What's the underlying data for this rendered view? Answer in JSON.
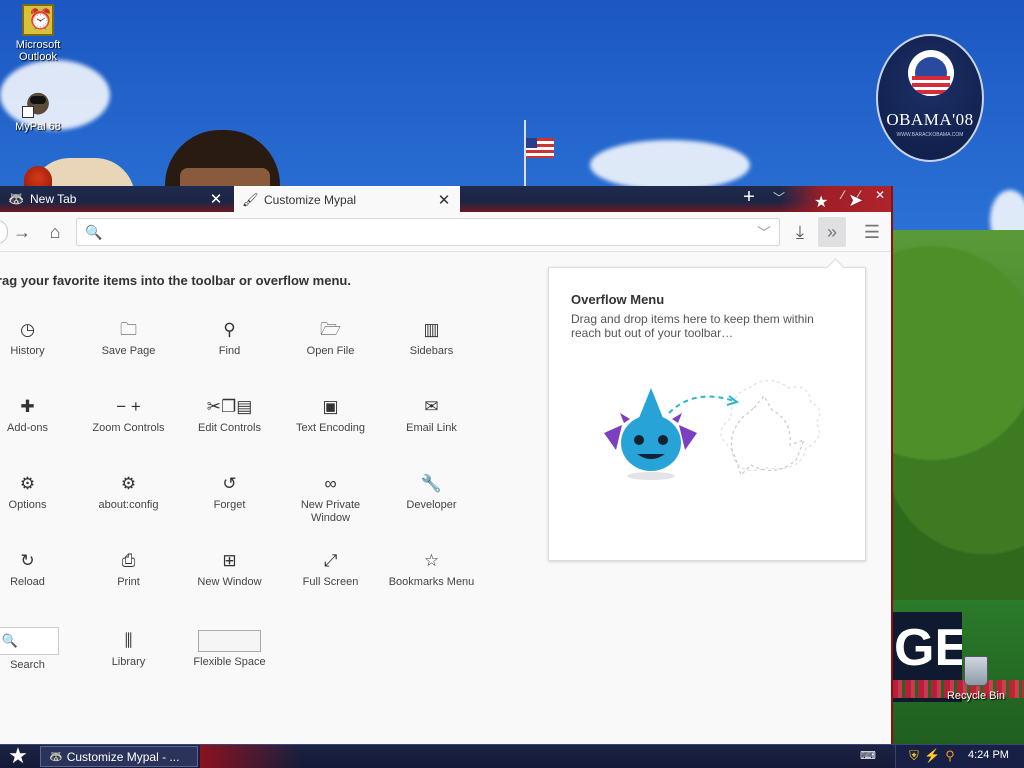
{
  "desktop": {
    "icons": [
      {
        "label": "Microsoft\nOutlook"
      },
      {
        "label": "MyPal 68"
      }
    ],
    "recycle_bin": "Recycle Bin",
    "logo": {
      "text": "OBAMA'08",
      "url": "WWW.BARACKOBAMA.COM"
    },
    "banner": {
      "big": "GE",
      "small": "VE IN"
    }
  },
  "browser": {
    "tabs": [
      {
        "label": "New Tab",
        "icon": "mypal-icon",
        "active": false
      },
      {
        "label": "Customize Mypal",
        "icon": "paintbrush-icon",
        "active": true
      }
    ],
    "urlbar": {
      "value": ""
    },
    "intro": "rag your favorite items into the toolbar or overflow menu.",
    "palette": [
      {
        "label": "History",
        "icon": "clock-icon"
      },
      {
        "label": "Save Page",
        "icon": "save-page-icon"
      },
      {
        "label": "Find",
        "icon": "magnifier-icon"
      },
      {
        "label": "Open File",
        "icon": "open-file-icon"
      },
      {
        "label": "Sidebars",
        "icon": "sidebar-icon"
      },
      {
        "label": "Add-ons",
        "icon": "puzzle-icon"
      },
      {
        "label": "Zoom Controls",
        "icon": "zoom-icon"
      },
      {
        "label": "Edit Controls",
        "icon": "cut-copy-paste-icon"
      },
      {
        "label": "Text Encoding",
        "icon": "text-encoding-icon"
      },
      {
        "label": "Email Link",
        "icon": "envelope-icon"
      },
      {
        "label": "Options",
        "icon": "gear-icon"
      },
      {
        "label": "about:config",
        "icon": "gear-icon"
      },
      {
        "label": "Forget",
        "icon": "forget-icon"
      },
      {
        "label": "New Private Window",
        "icon": "mask-icon"
      },
      {
        "label": "Developer",
        "icon": "wrench-icon"
      },
      {
        "label": "Reload",
        "icon": "reload-icon"
      },
      {
        "label": "Print",
        "icon": "printer-icon"
      },
      {
        "label": "New Window",
        "icon": "new-window-icon"
      },
      {
        "label": "Full Screen",
        "icon": "fullscreen-icon"
      },
      {
        "label": "Bookmarks Menu",
        "icon": "bookmark-star-icon"
      },
      {
        "label": "Search",
        "icon": "search-box-icon"
      },
      {
        "label": "Library",
        "icon": "library-icon"
      },
      {
        "label": "Flexible Space",
        "icon": "flexible-space-icon"
      }
    ],
    "overflow_panel": {
      "title": "Overflow Menu",
      "description": "Drag and drop items here to keep them within reach but out of your toolbar…"
    }
  },
  "taskbar": {
    "task_label": "Customize Mypal - ...",
    "clock": "4:24 PM"
  }
}
